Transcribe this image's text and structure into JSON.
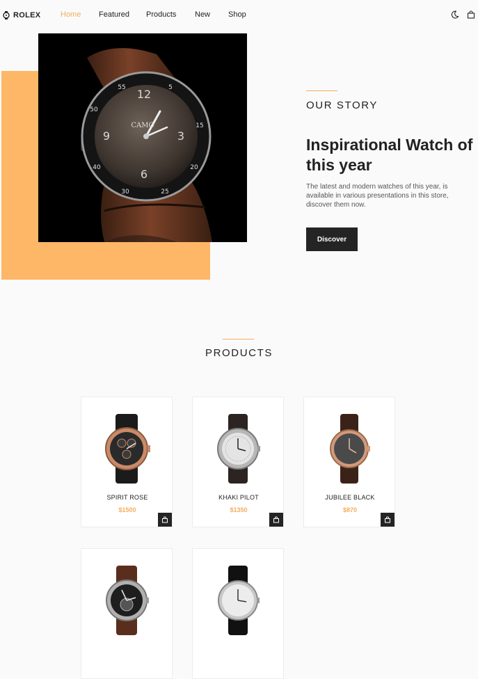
{
  "header": {
    "logo": "ROLEX",
    "nav": [
      "Home",
      "Featured",
      "Products",
      "New",
      "Shop"
    ],
    "active": "Home",
    "icons": [
      "moon-icon",
      "bag-icon"
    ]
  },
  "hero": {
    "kicker": "OUR STORY",
    "title": "Inspirational Watch of this year",
    "description": "The latest and modern watches of this year, is available in various presentations in this store, discover them now.",
    "button": "Discover",
    "image_icon": "watch-image",
    "colors": {
      "accent": "#fdb767",
      "dark": "#242424"
    }
  },
  "products": {
    "title": "PRODUCTS",
    "items": [
      {
        "name": "SPIRIT ROSE",
        "price": "$1500"
      },
      {
        "name": "KHAKI PILOT",
        "price": "$1350"
      },
      {
        "name": "JUBILEE BLACK",
        "price": "$870"
      },
      {
        "name": "",
        "price": ""
      },
      {
        "name": "",
        "price": ""
      }
    ]
  }
}
